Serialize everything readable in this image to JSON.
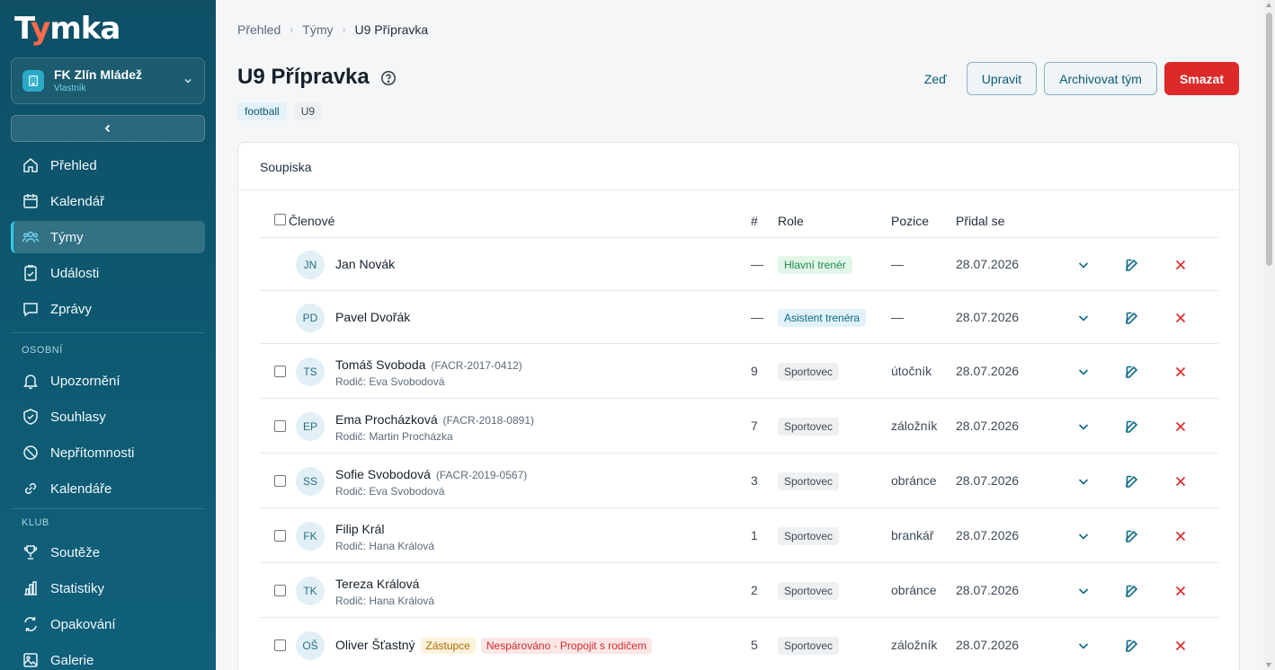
{
  "app": {
    "logo_main": "T",
    "logo_y": "y",
    "logo_rest": "mka"
  },
  "club": {
    "name": "FK Zlín Mládež",
    "role": "Vlastník"
  },
  "sidebar": {
    "items": [
      {
        "label": "Přehled",
        "icon": "home-icon"
      },
      {
        "label": "Kalendář",
        "icon": "calendar-icon"
      },
      {
        "label": "Týmy",
        "icon": "users-icon",
        "active": true
      },
      {
        "label": "Události",
        "icon": "clipboard-icon"
      },
      {
        "label": "Zprávy",
        "icon": "message-icon"
      }
    ],
    "section_personal": "OSOBNÍ",
    "personal_items": [
      {
        "label": "Upozornění",
        "icon": "bell-icon"
      },
      {
        "label": "Souhlasy",
        "icon": "shield-icon"
      },
      {
        "label": "Nepřítomnosti",
        "icon": "ban-icon"
      },
      {
        "label": "Kalendáře",
        "icon": "link-icon"
      }
    ],
    "section_club": "KLUB",
    "club_items": [
      {
        "label": "Soutěže",
        "icon": "trophy-icon"
      },
      {
        "label": "Statistiky",
        "icon": "chart-icon"
      },
      {
        "label": "Opakování",
        "icon": "repeat-icon"
      },
      {
        "label": "Galerie",
        "icon": "image-icon"
      }
    ]
  },
  "breadcrumb": {
    "items": [
      "Přehled",
      "Týmy",
      "U9 Přípravka"
    ]
  },
  "page": {
    "title": "U9 Přípravka",
    "tags": [
      "football",
      "U9"
    ]
  },
  "actions": {
    "wall": "Zeď",
    "edit": "Upravit",
    "archive": "Archivovat tým",
    "delete": "Smazat"
  },
  "roster": {
    "title": "Soupiska",
    "columns": {
      "members": "Členové",
      "number": "#",
      "role": "Role",
      "position": "Pozice",
      "added": "Přidal se"
    },
    "rows": [
      {
        "initials": "JN",
        "name": "Jan Novák",
        "reg": "",
        "parent": "",
        "number": "—",
        "role": "Hlavní trenér",
        "role_type": "coach",
        "position": "—",
        "date": "28.07.2026",
        "checkbox": false
      },
      {
        "initials": "PD",
        "name": "Pavel Dvořák",
        "reg": "",
        "parent": "",
        "number": "—",
        "role": "Asistent trenéra",
        "role_type": "assist",
        "position": "—",
        "date": "28.07.2026",
        "checkbox": false
      },
      {
        "initials": "TS",
        "name": "Tomáš Svoboda",
        "reg": "(FACR-2017-0412)",
        "parent": "Rodič: Eva Svobodová",
        "number": "9",
        "role": "Sportovec",
        "role_type": "athlete",
        "position": "útočník",
        "date": "28.07.2026",
        "checkbox": true
      },
      {
        "initials": "EP",
        "name": "Ema Procházková",
        "reg": "(FACR-2018-0891)",
        "parent": "Rodič: Martin Procházka",
        "number": "7",
        "role": "Sportovec",
        "role_type": "athlete",
        "position": "záložník",
        "date": "28.07.2026",
        "checkbox": true
      },
      {
        "initials": "SS",
        "name": "Sofie Svobodová",
        "reg": "(FACR-2019-0567)",
        "parent": "Rodič: Eva Svobodová",
        "number": "3",
        "role": "Sportovec",
        "role_type": "athlete",
        "position": "obránce",
        "date": "28.07.2026",
        "checkbox": true
      },
      {
        "initials": "FK",
        "name": "Filip Král",
        "reg": "",
        "parent": "Rodič: Hana Králová",
        "number": "1",
        "role": "Sportovec",
        "role_type": "athlete",
        "position": "brankář",
        "date": "28.07.2026",
        "checkbox": true
      },
      {
        "initials": "TK",
        "name": "Tereza Králová",
        "reg": "",
        "parent": "Rodič: Hana Králová",
        "number": "2",
        "role": "Sportovec",
        "role_type": "athlete",
        "position": "obránce",
        "date": "28.07.2026",
        "checkbox": true
      },
      {
        "initials": "OŠ",
        "name": "Oliver Šťastný",
        "reg": "",
        "parent": "",
        "badge_sub": "Zástupce",
        "badge_unpaired": "Nespárováno · Propojit s rodičem",
        "number": "5",
        "role": "Sportovec",
        "role_type": "athlete",
        "position": "záložník",
        "date": "28.07.2026",
        "checkbox": true
      }
    ]
  },
  "colors": {
    "sidebar": "#0e4f66",
    "accent": "#35c6e6",
    "danger": "#dc2a2a",
    "primary_text": "#0e5a75"
  }
}
